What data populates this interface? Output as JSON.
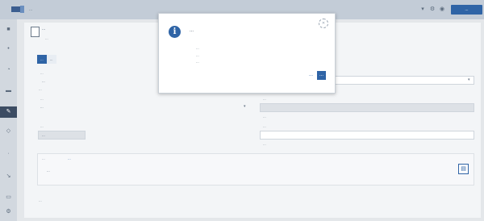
{
  "topbar": {
    "app_title": "...",
    "icons": [
      "grid-icon",
      "settings-icon",
      "user-icon"
    ],
    "action_label": "..."
  },
  "sidebar": {
    "items": [
      {
        "icon": "home-icon",
        "active": true
      },
      {
        "icon": "dot-icon"
      },
      {
        "icon": "chart-icon"
      },
      {
        "icon": "list-icon"
      },
      {
        "icon": "edit-icon",
        "active": true
      },
      {
        "icon": "document-icon"
      },
      {
        "icon": "filter-icon"
      },
      {
        "icon": "arrow-icon"
      },
      {
        "icon": "tag-icon"
      },
      {
        "icon": "gear-icon"
      }
    ]
  },
  "header": {
    "title": "...",
    "subtitle": "..."
  },
  "tabs": [
    {
      "label": "...",
      "active": true
    },
    {
      "label": "..."
    }
  ],
  "form": {
    "left": [
      {
        "label": "...",
        "value": "..."
      },
      {
        "label": "...",
        "value": "..."
      },
      {
        "label": "...",
        "value": "..."
      },
      {
        "label": "...",
        "value": "..."
      }
    ],
    "right": [
      {
        "label": "...",
        "value": ""
      },
      {
        "label": "...",
        "value": ""
      },
      {
        "label": "...",
        "value": ""
      },
      {
        "label": "...",
        "value": ""
      }
    ]
  },
  "panel": {
    "title": "...",
    "link": "...",
    "item": "..."
  },
  "footer_text": "...",
  "modal": {
    "title": "...",
    "lines": [
      "...",
      "...",
      "..."
    ],
    "close_icon": "spinner-icon",
    "buttons": [
      "...",
      "..."
    ]
  }
}
